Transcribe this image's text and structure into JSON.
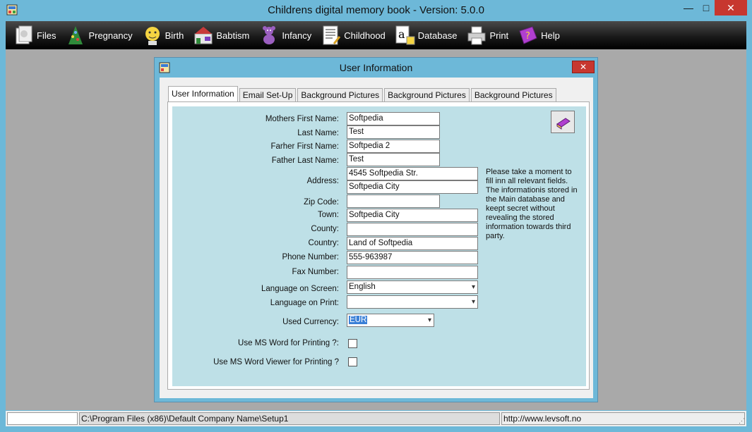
{
  "window": {
    "title": "Childrens digital memory book -  Version: 5.0.0",
    "min_glyph": "—",
    "max_glyph": "□",
    "close_glyph": "✕"
  },
  "menu": [
    {
      "label": "Files",
      "icon": "files-icon"
    },
    {
      "label": "Pregnancy",
      "icon": "pregnancy-icon"
    },
    {
      "label": "Birth",
      "icon": "birth-icon"
    },
    {
      "label": "Babtism",
      "icon": "babtism-icon"
    },
    {
      "label": "Infancy",
      "icon": "infancy-icon"
    },
    {
      "label": "Childhood",
      "icon": "childhood-icon"
    },
    {
      "label": "Database",
      "icon": "database-icon"
    },
    {
      "label": "Print",
      "icon": "print-icon"
    },
    {
      "label": "Help",
      "icon": "help-icon"
    }
  ],
  "dialog": {
    "title": "User Information",
    "close_glyph": "✕",
    "tabs": [
      "User Information",
      "Email Set-Up",
      "Background Pictures",
      "Background Pictures",
      "Background Pictures"
    ],
    "active_tab": 0,
    "fields": {
      "mothers_first_name": {
        "label": "Mothers First Name:",
        "value": "Softpedia"
      },
      "last_name": {
        "label": "Last Name:",
        "value": "Test"
      },
      "father_first_name": {
        "label": "Farher First Name:",
        "value": "Softpedia 2"
      },
      "father_last_name": {
        "label": "Father Last Name:",
        "value": "Test"
      },
      "address": {
        "label": "Address:",
        "line1": "4545 Softpedia Str.",
        "line2": "Softpedia City"
      },
      "zip_code": {
        "label": "Zip Code:",
        "value": ""
      },
      "town": {
        "label": "Town:",
        "value": "Softpedia City"
      },
      "county": {
        "label": "County:",
        "value": ""
      },
      "country": {
        "label": "Country:",
        "value": "Land of Softpedia"
      },
      "phone": {
        "label": "Phone Number:",
        "value": "555-963987"
      },
      "fax": {
        "label": "Fax Number:",
        "value": ""
      },
      "language_screen": {
        "label": "Language on Screen:",
        "value": "English"
      },
      "language_print": {
        "label": "Language on Print:",
        "value": ""
      },
      "currency": {
        "label": "Used Currency:",
        "value": "EUR"
      },
      "use_ms_word": {
        "label": "Use MS Word for Printing ?:",
        "checked": false
      },
      "use_ms_word_viewer": {
        "label": "Use MS Word Viewer for Printing ?",
        "checked": false
      }
    },
    "info_text": "Please take a moment to fill inn all relevant fields. The informationis stored in the Main database and keept secret without revealing the stored information towards third party.",
    "book_icon": "book-icon",
    "select_caret": "▾"
  },
  "statusbar": {
    "path": "C:\\Program Files (x86)\\Default Company Name\\Setup1",
    "url": "http://www.levsoft.no"
  },
  "colors": {
    "frame": "#6db8d8",
    "menubar": "#000000",
    "panel": "#bee0e7",
    "close": "#c7372f"
  }
}
